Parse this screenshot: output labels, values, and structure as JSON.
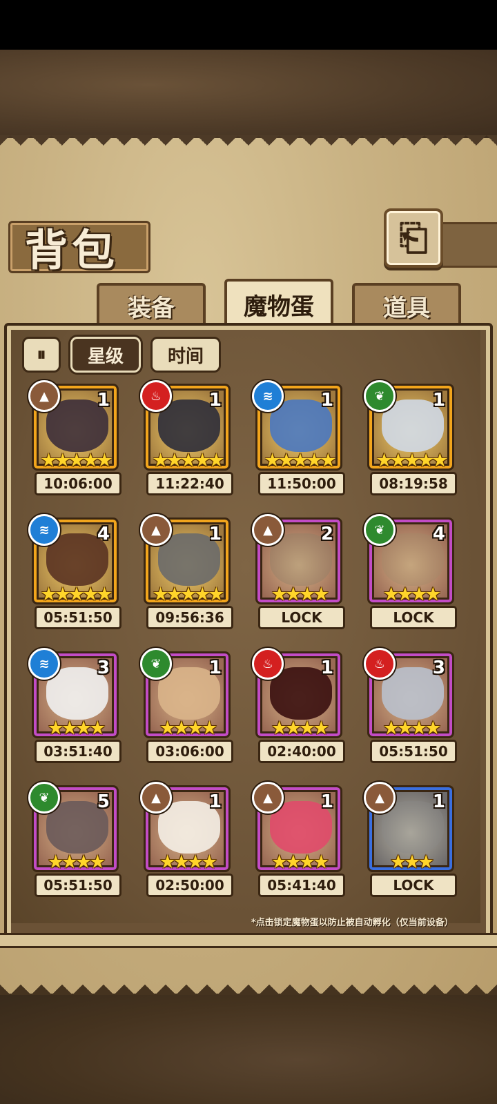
{
  "page": {
    "title": "背包",
    "back_icon": "return-arrow-icon"
  },
  "tabs": [
    {
      "label": "装备",
      "active": false
    },
    {
      "label": "魔物蛋",
      "active": true
    },
    {
      "label": "道具",
      "active": false
    }
  ],
  "sort": {
    "toggle_icon": "sort-order-icon",
    "star_label": "星级",
    "time_label": "时间",
    "active": "星级"
  },
  "note": "*点击锁定魔物蛋以防止被自动孵化（仅当前设备）",
  "elements": {
    "earth": {
      "icon": "mountain-icon",
      "color": "#8a5a3a"
    },
    "fire": {
      "icon": "flame-icon",
      "color": "#d42020"
    },
    "water": {
      "icon": "wave-icon",
      "color": "#1f7fd6"
    },
    "leaf": {
      "icon": "leaf-icon",
      "color": "#2e8a2e"
    }
  },
  "eggs": [
    {
      "element": "earth",
      "count": "1",
      "stars": 5,
      "rarity": "gold",
      "timer": "10:06:00",
      "name": "coffin-egg"
    },
    {
      "element": "fire",
      "count": "1",
      "stars": 5,
      "rarity": "gold",
      "timer": "11:22:40",
      "name": "pirate-hat-egg"
    },
    {
      "element": "water",
      "count": "1",
      "stars": 5,
      "rarity": "gold",
      "timer": "11:50:00",
      "name": "shark-helmet-egg"
    },
    {
      "element": "leaf",
      "count": "1",
      "stars": 5,
      "rarity": "gold",
      "timer": "08:19:58",
      "name": "pocket-watch-egg"
    },
    {
      "element": "water",
      "count": "4",
      "stars": 5,
      "rarity": "gold",
      "timer": "05:51:50",
      "name": "twisted-staff-egg"
    },
    {
      "element": "earth",
      "count": "1",
      "stars": 5,
      "rarity": "gold",
      "timer": "09:56:36",
      "name": "spiky-rock-egg"
    },
    {
      "element": "earth",
      "count": "2",
      "stars": 4,
      "rarity": "purple",
      "timer": "LOCK",
      "name": "beetle-egg",
      "locked": true
    },
    {
      "element": "leaf",
      "count": "4",
      "stars": 4,
      "rarity": "purple",
      "timer": "LOCK",
      "name": "plant-bulb-egg",
      "locked": true
    },
    {
      "element": "water",
      "count": "3",
      "stars": 4,
      "rarity": "purple",
      "timer": "03:51:40",
      "name": "panda-skull-egg"
    },
    {
      "element": "leaf",
      "count": "1",
      "stars": 4,
      "rarity": "purple",
      "timer": "03:06:00",
      "name": "tiger-egg"
    },
    {
      "element": "fire",
      "count": "1",
      "stars": 4,
      "rarity": "purple",
      "timer": "02:40:00",
      "name": "lava-egg"
    },
    {
      "element": "fire",
      "count": "3",
      "stars": 4,
      "rarity": "purple",
      "timer": "05:51:50",
      "name": "shield-egg"
    },
    {
      "element": "leaf",
      "count": "5",
      "stars": 4,
      "rarity": "purple",
      "timer": "05:51:50",
      "name": "kunai-egg"
    },
    {
      "element": "earth",
      "count": "1",
      "stars": 4,
      "rarity": "purple",
      "timer": "02:50:00",
      "name": "shell-egg"
    },
    {
      "element": "earth",
      "count": "1",
      "stars": 4,
      "rarity": "purple",
      "timer": "05:41:40",
      "name": "thorn-egg"
    },
    {
      "element": "earth",
      "count": "1",
      "stars": 3,
      "rarity": "blue",
      "timer": "LOCK",
      "name": "book-egg",
      "locked": true
    }
  ]
}
